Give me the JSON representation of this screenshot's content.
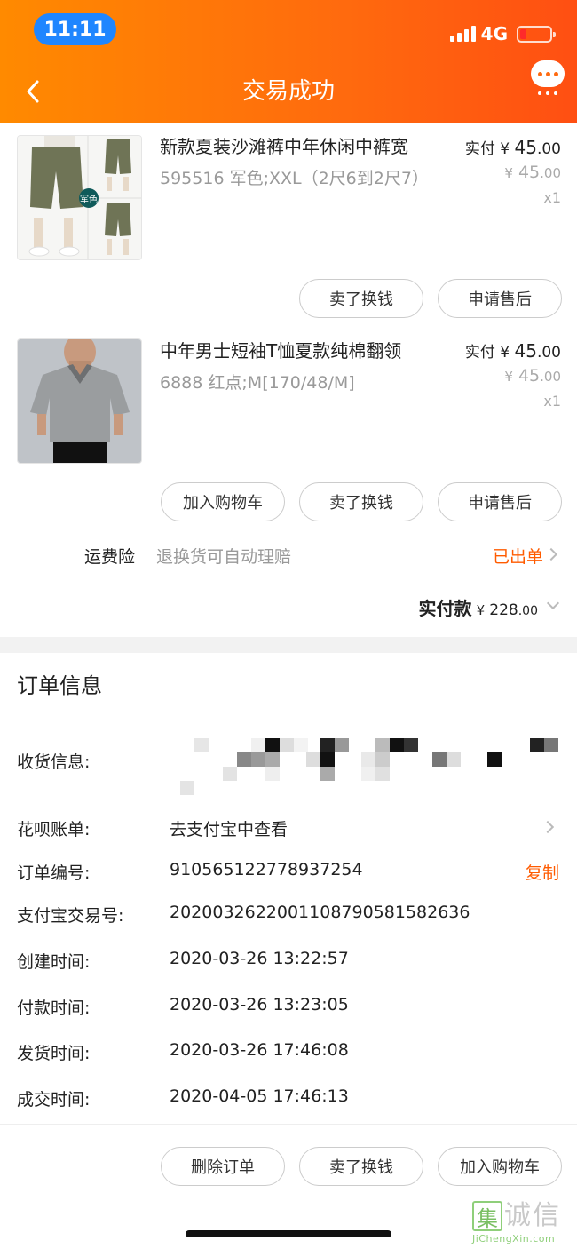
{
  "status_bar": {
    "time": "11:11",
    "network": "4G"
  },
  "header": {
    "title": "交易成功"
  },
  "products": [
    {
      "title": "新款夏装沙滩裤中年休闲中裤宽",
      "sku": "595516 军色;XXL（2尺6到2尺7）",
      "paid_label": "实付",
      "currency": "¥",
      "paid_int": "45",
      "paid_dec": ".00",
      "orig_int": "45",
      "orig_dec": ".00",
      "qty": "x1",
      "thumb_tag": "军色",
      "buttons": [
        "卖了换钱",
        "申请售后"
      ]
    },
    {
      "title": "中年男士短袖T恤夏款纯棉翻领",
      "sku": "6888 红点;M[170/48/M]",
      "paid_label": "实付",
      "currency": "¥",
      "paid_int": "45",
      "paid_dec": ".00",
      "orig_int": "45",
      "orig_dec": ".00",
      "qty": "x1",
      "buttons": [
        "加入购物车",
        "卖了换钱",
        "申请售后"
      ]
    }
  ],
  "freight": {
    "label": "运费险",
    "desc": "退换货可自动理赔",
    "status": "已出单"
  },
  "total": {
    "label": "实付款",
    "currency": "¥",
    "amount": "228",
    "dec": ".00"
  },
  "order_info": {
    "title": "订单信息",
    "rows": [
      {
        "label": "收货信息:",
        "value": ""
      },
      {
        "label": "花呗账单:",
        "value": "去支付宝中查看"
      },
      {
        "label": "订单编号:",
        "value": "910565122778937254",
        "action": "复制"
      },
      {
        "label": "支付宝交易号:",
        "value": "2020032622001108790581582636"
      },
      {
        "label": "创建时间:",
        "value": "2020-03-26 13:22:57"
      },
      {
        "label": "付款时间:",
        "value": "2020-03-26 13:23:05"
      },
      {
        "label": "发货时间:",
        "value": "2020-03-26 17:46:08"
      },
      {
        "label": "成交时间:",
        "value": "2020-04-05 17:46:13"
      }
    ]
  },
  "bottom_actions": [
    "删除订单",
    "卖了换钱",
    "加入购物车"
  ],
  "watermark": {
    "chars": [
      "集",
      "诚",
      "信"
    ],
    "site": "JiChengXin.com"
  },
  "colors": {
    "accent": "#ff5b00",
    "header_start": "#ff8a00",
    "header_end": "#ff4f12"
  }
}
